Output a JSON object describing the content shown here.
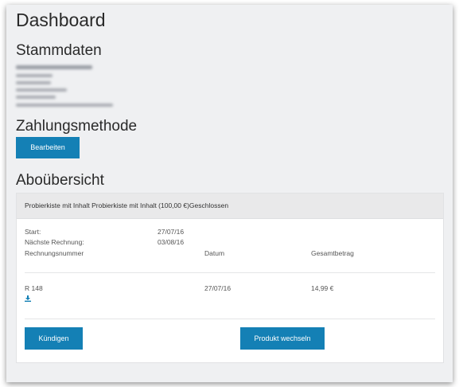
{
  "page": {
    "title": "Dashboard"
  },
  "sections": {
    "stammdaten": "Stammdaten",
    "zahlungsmethode": "Zahlungsmethode",
    "abouebersicht": "Aboübersicht"
  },
  "buttons": {
    "bearbeiten": "Bearbeiten",
    "kuendigen": "Kündigen",
    "produkt_wechseln": "Produkt wechseln"
  },
  "subscription": {
    "header": "Probierkiste mit Inhalt Probierkiste mit Inhalt (100,00 €)Geschlossen",
    "start_label": "Start:",
    "start_value": "27/07/16",
    "next_invoice_label": "Nächste Rechnung:",
    "next_invoice_value": "03/08/16"
  },
  "invoice_table": {
    "columns": [
      "Rechnungsnummer",
      "Datum",
      "Gesamtbetrag"
    ],
    "rows": [
      {
        "number": "R 148",
        "date": "27/07/16",
        "amount": "14,99 €"
      }
    ]
  },
  "colors": {
    "accent": "#1480b5",
    "background": "#eff0f2",
    "panel_header": "#e9e9ea"
  },
  "icons": {
    "invoice_download": "download-icon"
  }
}
